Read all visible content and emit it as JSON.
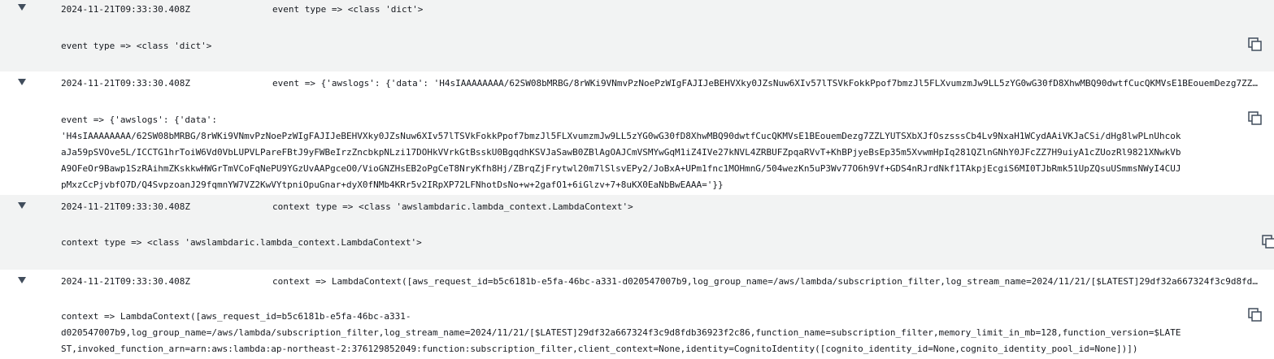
{
  "entries": [
    {
      "timestamp": "2024-11-21T09:33:30.408Z",
      "message": "event type => <class 'dict'>",
      "detail": "event type => <class 'dict'>"
    },
    {
      "timestamp": "2024-11-21T09:33:30.408Z",
      "message": "event => {'awslogs': {'data': 'H4sIAAAAAAAA/62SW08bMRBG/8rWKi9VNmvPzNoePzWIgFAJIJeBEHVXky0JZsNuw6XIv57lTSVkFokkPpof7bmzJl5FLXvumzmJw9LL5zYG0wG30fD8XhwMBQ90dwtfCucQKMVsE1BEouemDezg7ZZL…",
      "detail": "event => {'awslogs': {'data':\n'H4sIAAAAAAAA/62SW08bMRBG/8rWKi9VNmvPzNoePzWIgFAJIJeBEHVXky0JZsNuw6XIv57lTSVkFokkPpof7bmzJl5FLXvumzmJw9LL5zYG0wG30fD8XhwMBQ90dwtfCucQKMVsE1BEouemDezg7ZZLYUTSXbXJfOszsssCb4Lv9NxaH1WCydAAiVKJaCSi/dHg8lwPLnUhcokaJa59pSVOve5L/ICCTG1hrToiW6Vd0VbLUPVLPareFBtJ9yFWBeIrzZncbkpNLzi17DOHkVVrkGtBsskU0BgqdhKSVJaSawB0ZBlAgOAJCmVSMYwGqM1iZ4IVe27kNVL4ZRBUFZpqaRVvT+KhBPjyeBsEp35m5XvwmHpIq281QZlnGNhY0JFcZZ7H9uiyA1cZUozRl9821XNwkVbA9OFeOr9Bawp1SzRAihmZKskkwHWGrTmVCoFqNePU9YGzUvAAPgceO0/VioGNZHsEB2oPgCeT8NryKfh8Hj/ZBrqZjFrytwl20m7lSlsvEPy2/JoBxA+UPm1fnc1MOHmnG/504wezKn5uP3Wv77O6h9Vf+GDS4nRJrdNkf1TAkpjEcgiS6MI0TJbRmk51UpZQsuUSmmsNWyI4CUJpMxzCcPjvbfO7D/Q4SvpzoanJ29fqmnYW7VZ2KwVYtpniOpuGnar+dyX0fNMb4KRr5v2IRpXP72LFNhotDsNo+w+2gafO1+6iGlzv+7+8uKX0EaNbBwEAAA='}}"
    },
    {
      "timestamp": "2024-11-21T09:33:30.408Z",
      "message": "context type => <class 'awslambdaric.lambda_context.LambdaContext'>",
      "detail": "context type => <class 'awslambdaric.lambda_context.LambdaContext'>"
    },
    {
      "timestamp": "2024-11-21T09:33:30.408Z",
      "message": "context => LambdaContext([aws_request_id=b5c6181b-e5fa-46bc-a331-d020547007b9,log_group_name=/aws/lambda/subscription_filter,log_stream_name=2024/11/21/[$LATEST]29df32a667324f3c9d8fdb…",
      "detail": "context => LambdaContext([aws_request_id=b5c6181b-e5fa-46bc-a331-\nd020547007b9,log_group_name=/aws/lambda/subscription_filter,log_stream_name=2024/11/21/[$LATEST]29df32a667324f3c9d8fdb36923f2c86,function_name=subscription_filter,memory_limit_in_mb=128,function_version=$LATEST,invoked_function_arn=arn:aws:lambda:ap-northeast-2:376129852049:function:subscription_filter,client_context=None,identity=CognitoIdentity([cognito_identity_id=None,cognito_identity_pool_id=None])])"
    }
  ]
}
